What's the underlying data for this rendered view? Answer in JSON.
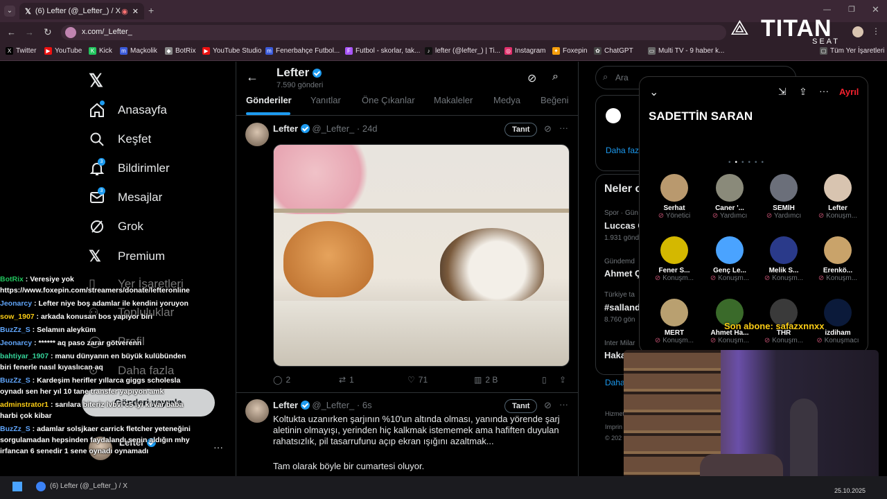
{
  "browser": {
    "tab_title": "(6) Lefter (@_Lefter_) / X",
    "url": "x.com/_Lefter_",
    "bookmarks": [
      "Twitter",
      "YouTube",
      "Kick",
      "Maçkolik",
      "BotRix",
      "YouTube Studio",
      "Fenerbahçe Futbol...",
      "Futbol - skorlar, tak...",
      "lefter (@lefter_) | Ti...",
      "Instagram",
      "Foxepin",
      "ChatGPT",
      "Multi TV - 9 haber k..."
    ],
    "all_bookmarks": "Tüm Yer İşaretleri"
  },
  "overlay_logo": {
    "brand": "TITAN",
    "sub": "SEAT"
  },
  "nav": {
    "items": [
      {
        "label": "Anasayfa",
        "badge": ""
      },
      {
        "label": "Keşfet",
        "badge": ""
      },
      {
        "label": "Bildirimler",
        "badge": "3"
      },
      {
        "label": "Mesajlar",
        "badge": "3"
      },
      {
        "label": "Grok",
        "badge": ""
      },
      {
        "label": "Premium",
        "badge": ""
      },
      {
        "label": "Yer İşaretleri",
        "badge": ""
      },
      {
        "label": "Topluluklar",
        "badge": ""
      },
      {
        "label": "Profil",
        "badge": ""
      },
      {
        "label": "Daha fazla",
        "badge": ""
      }
    ],
    "post_button": "Gönderi yayınla",
    "account_name": "Lefter"
  },
  "profile": {
    "name": "Lefter",
    "posts_count": "7.590 gönderi",
    "tabs": [
      "Gönderiler",
      "Yanıtlar",
      "Öne Çıkanlar",
      "Makaleler",
      "Medya",
      "Beğeni"
    ]
  },
  "posts": [
    {
      "name": "Lefter",
      "handle": "@_Lefter_",
      "time": "24d",
      "follow": "Tanıt",
      "replies": "2",
      "reposts": "1",
      "likes": "71",
      "views": "2 B",
      "text": ""
    },
    {
      "name": "Lefter",
      "handle": "@_Lefter_",
      "time": "6s",
      "follow": "Tanıt",
      "text": "Koltukta uzanırken şarjının %10'un altında olması, yanında yörende şarj aletinin olmayışı, yerinden hiç kalkmak istememek ama hafiften duyulan rahatsızlık, pil tasarrufunu açıp ekran ışığını azaltmak...",
      "text2": "Tam olarak böyle bir cumartesi oluyor."
    }
  ],
  "right": {
    "search_placeholder": "Ara",
    "more": "Daha faz",
    "trends_title": "Neler o",
    "trends": [
      {
        "cat": "Spor · Gün",
        "title": "Luccas C",
        "count": "1.931 gönd"
      },
      {
        "cat": "Gündemd",
        "title": "Ahmet Ç",
        "count": ""
      },
      {
        "cat": "Türkiye ta",
        "title": "#salland",
        "count": "8.760 gön"
      },
      {
        "cat": "Inter Milar",
        "title": "Hakan",
        "count": ""
      }
    ],
    "more2": "Daha",
    "footer": [
      "Hizmet",
      "Imprin",
      "© 202"
    ]
  },
  "spaces": {
    "title": "SADETTİN SARAN",
    "leave": "Ayrıl",
    "participants": [
      {
        "name": "Serhat",
        "role": "Yönetici",
        "verified": false
      },
      {
        "name": "Caner '...",
        "role": "Yardımcı",
        "verified": true
      },
      {
        "name": "SEMİH",
        "role": "Yardımcı",
        "verified": true
      },
      {
        "name": "Lefter",
        "role": "Konuşm...",
        "verified": true
      },
      {
        "name": "Fener S...",
        "role": "Konuşm...",
        "verified": true
      },
      {
        "name": "Genç Le...",
        "role": "Konuşm...",
        "verified": true
      },
      {
        "name": "Melik S...",
        "role": "Konuşm...",
        "verified": true
      },
      {
        "name": "Erenkö...",
        "role": "Konuşm...",
        "verified": true
      },
      {
        "name": "MERT",
        "role": "Konuşm...",
        "verified": true
      },
      {
        "name": "Ahmet Ha...",
        "role": "Konuşm...",
        "verified": false
      },
      {
        "name": "THR",
        "role": "Konuşm...",
        "verified": false
      },
      {
        "name": "izdiham",
        "role": "Konuşmacı",
        "verified": false
      }
    ],
    "last_sub": "Son abone: safazxnnxx"
  },
  "chat": [
    {
      "user": "BotRix",
      "color": "#22c55e",
      "text": "Veresiye yok https://www.foxepin.com/streamers/donate/lefteronline"
    },
    {
      "user": "Jeonarcy",
      "color": "#60a5fa",
      "text": "Lefter niye boş adamlar ile kendini yoruyon"
    },
    {
      "user": "sow_1907",
      "color": "#facc15",
      "text": "arkada konusan bos yapiyor biri"
    },
    {
      "user": "BuzZz_S",
      "color": "#60a5fa",
      "text": "Selamın aleyküm"
    },
    {
      "user": "Jeonarcy",
      "color": "#60a5fa",
      "text": "****** aq paso zarar götverenn"
    },
    {
      "user": "bahtiyar_1907",
      "color": "#34d399",
      "text": "manu dünyanın en büyük kulübünden biri fenerle nasıl kıyaslıcan aq"
    },
    {
      "user": "BuzZz_S",
      "color": "#60a5fa",
      "text": "Kardeşim herifler yıllarca giggs scholesla oynadı sen her yıl 10 tane transfer yapıyon amk"
    },
    {
      "user": "adminstrator1",
      "color": "#facc15",
      "text": "sarılara biteriz lvbvl c5 iyi ki var baba harbi çok kibar"
    },
    {
      "user": "BuzZz_S",
      "color": "#60a5fa",
      "text": "adamlar solsjkaer carrick fletcher yeteneğini sorgulamadan hepsinden faydalandı senin aldığın mhy irfancan 6 senedir 1 sene oynadı oynamadı"
    }
  ],
  "taskbar": {
    "item": "(6) Lefter (@_Lefter_) / X",
    "date": "25.10.2025"
  }
}
